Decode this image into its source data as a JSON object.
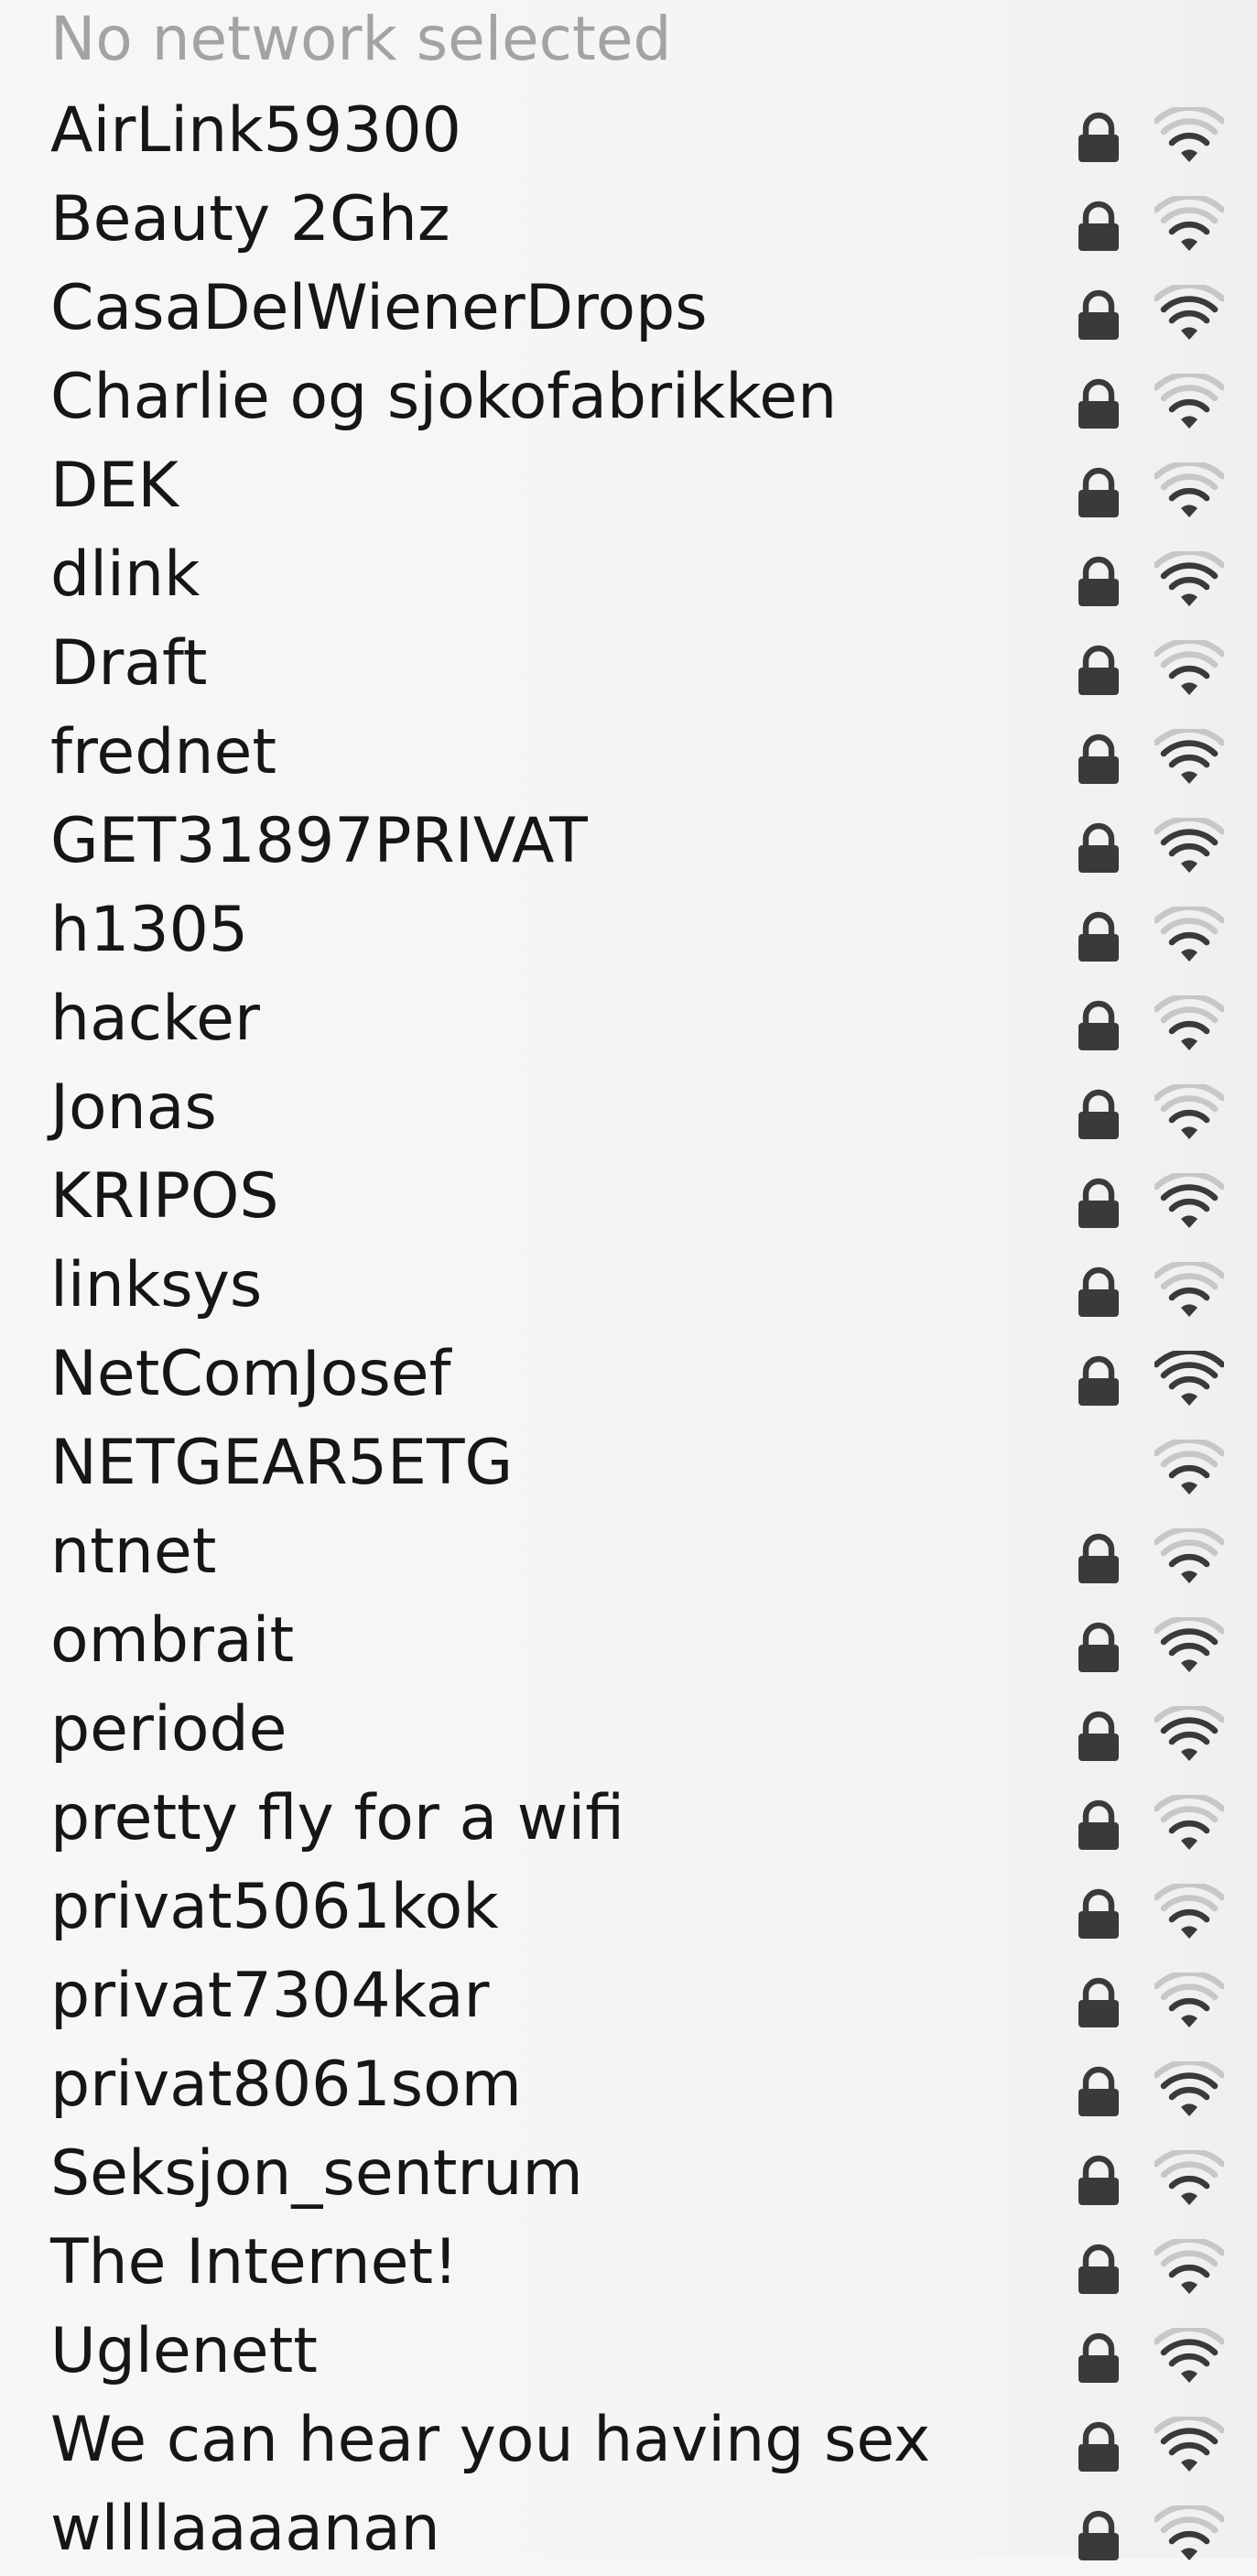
{
  "header": {
    "label": "No network selected"
  },
  "icons": {
    "lock": "lock-icon",
    "wifi": "wifi-signal-icon"
  },
  "colors": {
    "text": "#161616",
    "header_text": "#a3a3a3",
    "icon": "#3a3a3a",
    "icon_dim": "#c7c7c7"
  },
  "networks": [
    {
      "name": "AirLink59300",
      "secured": true,
      "signal_bars": 1
    },
    {
      "name": "Beauty 2Ghz",
      "secured": true,
      "signal_bars": 1
    },
    {
      "name": "CasaDelWienerDrops",
      "secured": true,
      "signal_bars": 2
    },
    {
      "name": "Charlie og sjokofabrikken",
      "secured": true,
      "signal_bars": 1
    },
    {
      "name": "DEK",
      "secured": true,
      "signal_bars": 1
    },
    {
      "name": "dlink",
      "secured": true,
      "signal_bars": 2
    },
    {
      "name": "Draft",
      "secured": true,
      "signal_bars": 1
    },
    {
      "name": "frednet",
      "secured": true,
      "signal_bars": 2
    },
    {
      "name": "GET31897PRIVAT",
      "secured": true,
      "signal_bars": 2
    },
    {
      "name": "h1305",
      "secured": true,
      "signal_bars": 1
    },
    {
      "name": "hacker",
      "secured": true,
      "signal_bars": 1
    },
    {
      "name": "Jonas",
      "secured": true,
      "signal_bars": 1
    },
    {
      "name": "KRIPOS",
      "secured": true,
      "signal_bars": 2
    },
    {
      "name": "linksys",
      "secured": true,
      "signal_bars": 1
    },
    {
      "name": "NetComJosef",
      "secured": true,
      "signal_bars": 3
    },
    {
      "name": "NETGEAR5ETG",
      "secured": false,
      "signal_bars": 1
    },
    {
      "name": "ntnet",
      "secured": true,
      "signal_bars": 1
    },
    {
      "name": "ombrait",
      "secured": true,
      "signal_bars": 2
    },
    {
      "name": "periode",
      "secured": true,
      "signal_bars": 2
    },
    {
      "name": "pretty fly for a wifi",
      "secured": true,
      "signal_bars": 1
    },
    {
      "name": "privat5061kok",
      "secured": true,
      "signal_bars": 1
    },
    {
      "name": "privat7304kar",
      "secured": true,
      "signal_bars": 1
    },
    {
      "name": "privat8061som",
      "secured": true,
      "signal_bars": 2
    },
    {
      "name": "Seksjon_sentrum",
      "secured": true,
      "signal_bars": 1
    },
    {
      "name": "The Internet!",
      "secured": true,
      "signal_bars": 1
    },
    {
      "name": "Uglenett",
      "secured": true,
      "signal_bars": 2
    },
    {
      "name": "We can hear you having sex",
      "secured": true,
      "signal_bars": 2
    },
    {
      "name": "wllllaaaanan",
      "secured": true,
      "signal_bars": 1
    }
  ]
}
